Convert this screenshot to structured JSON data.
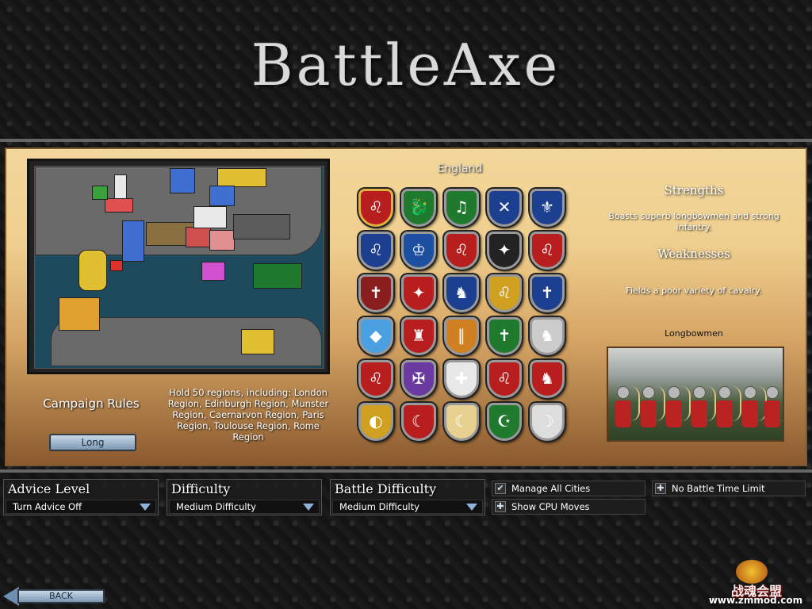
{
  "title": "BattleAxe",
  "campaign_rules_label": "Campaign Rules",
  "campaign_length": "Long",
  "victory_conditions": "Hold 50 regions, including: London Region, Edinburgh Region, Munster Region, Caernarvon Region, Paris Region, Toulouse Region, Rome Region",
  "selected_faction": "England",
  "faction_shields": [
    {
      "symbol": "lions",
      "color": "#b81e1e",
      "glyph": "♌"
    },
    {
      "symbol": "dragon",
      "color": "#1f7a2e",
      "glyph": "🐉"
    },
    {
      "symbol": "harp",
      "color": "#1f7a2e",
      "glyph": "♫"
    },
    {
      "symbol": "saltire",
      "color": "#1c3f8f",
      "glyph": "✕"
    },
    {
      "symbol": "fleur-de-lis",
      "color": "#1c3f8f",
      "glyph": "⚜"
    },
    {
      "symbol": "lion-blue",
      "color": "#1c3f8f",
      "glyph": "♌"
    },
    {
      "symbol": "crowns",
      "color": "#1c4f9f",
      "glyph": "♔"
    },
    {
      "symbol": "lion-red",
      "color": "#b81e1e",
      "glyph": "♌"
    },
    {
      "symbol": "eagle",
      "color": "#222222",
      "glyph": "✦"
    },
    {
      "symbol": "lion-white",
      "color": "#b81e1e",
      "glyph": "♌"
    },
    {
      "symbol": "cross-hill",
      "color": "#8a1e1e",
      "glyph": "✝"
    },
    {
      "symbol": "eagle-white",
      "color": "#b81e1e",
      "glyph": "✦"
    },
    {
      "symbol": "wolf",
      "color": "#1c3f8f",
      "glyph": "♞"
    },
    {
      "symbol": "lion-gold",
      "color": "#d0a020",
      "glyph": "♌"
    },
    {
      "symbol": "cross-blue",
      "color": "#1c3f8f",
      "glyph": "✝"
    },
    {
      "symbol": "lozenges",
      "color": "#4aa0e0",
      "glyph": "◆"
    },
    {
      "symbol": "castle",
      "color": "#b81e1e",
      "glyph": "♜"
    },
    {
      "symbol": "pallets",
      "color": "#d08020",
      "glyph": "∥"
    },
    {
      "symbol": "cross-green",
      "color": "#1f7a2e",
      "glyph": "✝"
    },
    {
      "symbol": "wolf-white",
      "color": "#cccccc",
      "glyph": "♞"
    },
    {
      "symbol": "lion-gold-red",
      "color": "#b81e1e",
      "glyph": "♌"
    },
    {
      "symbol": "jerusalem-cross",
      "color": "#6a3aa0",
      "glyph": "✠"
    },
    {
      "symbol": "st-george",
      "color": "#e8e8e8",
      "glyph": "✚"
    },
    {
      "symbol": "lion-yellow",
      "color": "#b81e1e",
      "glyph": "♌"
    },
    {
      "symbol": "horse",
      "color": "#b81e1e",
      "glyph": "♞"
    },
    {
      "symbol": "sun",
      "color": "#d0a020",
      "glyph": "◐"
    },
    {
      "symbol": "crescent-red",
      "color": "#b81e1e",
      "glyph": "☾"
    },
    {
      "symbol": "three-crescents",
      "color": "#e8d090",
      "glyph": "☾"
    },
    {
      "symbol": "crescent-green",
      "color": "#1f7a2e",
      "glyph": "☪"
    },
    {
      "symbol": "crescent-white",
      "color": "#dddddd",
      "glyph": "☽"
    }
  ],
  "strengths_heading": "Strengths",
  "strengths_text": "Boasts superb longbowmen and strong infantry.",
  "weaknesses_heading": "Weaknesses",
  "weaknesses_text": "Fields a poor variety of cavalry.",
  "unit_name": "Longbowmen",
  "options": {
    "advice": {
      "title": "Advice Level",
      "value": "Turn Advice Off"
    },
    "difficulty": {
      "title": "Difficulty",
      "value": "Medium Difficulty"
    },
    "battle_difficulty": {
      "title": "Battle Difficulty",
      "value": "Medium Difficulty"
    }
  },
  "toggles": {
    "manage_all_cities": {
      "label": "Manage All Cities",
      "checked": true
    },
    "show_cpu_moves": {
      "label": "Show CPU Moves",
      "checked": false
    },
    "no_battle_time_limit": {
      "label": "No Battle Time Limit",
      "checked": false
    }
  },
  "back_label": "BACK",
  "logo": {
    "text": "www.zmmod.com",
    "cn": "战魂会盟"
  }
}
